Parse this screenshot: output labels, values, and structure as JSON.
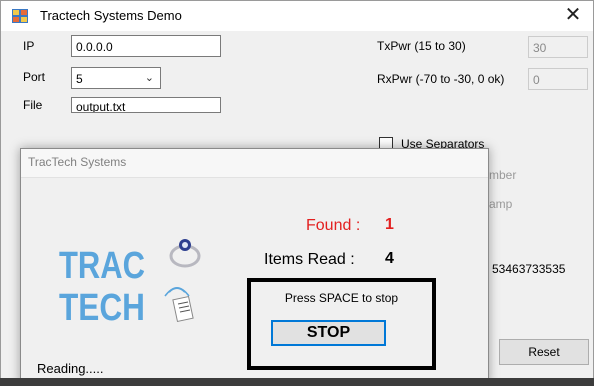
{
  "window": {
    "title": "Tractech Systems Demo",
    "close_glyph": "✕"
  },
  "form": {
    "ip_label": "IP",
    "ip_value": "0.0.0.0",
    "port_label": "Port",
    "port_value": "5",
    "file_label": "File",
    "file_value": "output.txt",
    "txpwr_label": "TxPwr (15 to 30)",
    "txpwr_value": "30",
    "rxpwr_label": "RxPwr (-70 to -30, 0 ok)",
    "rxpwr_value": "0",
    "use_separators_label": "Use Separators",
    "partial_label_1": "mber",
    "partial_label_2": "amp",
    "partial_value": "53463733535",
    "reset_label": "Reset"
  },
  "popup": {
    "title": "TracTech Systems",
    "found_label": "Found :",
    "found_value": "1",
    "items_label": "Items Read :",
    "items_value": "4",
    "press_text": "Press SPACE to stop",
    "stop_label": "STOP",
    "status_text": "Reading.....",
    "logo_text_line1": "TRAC",
    "logo_text_line2": "TECH"
  },
  "colors": {
    "found": "#e32020",
    "logo_blue": "#5aa5dc",
    "focus_blue": "#0078d7"
  }
}
